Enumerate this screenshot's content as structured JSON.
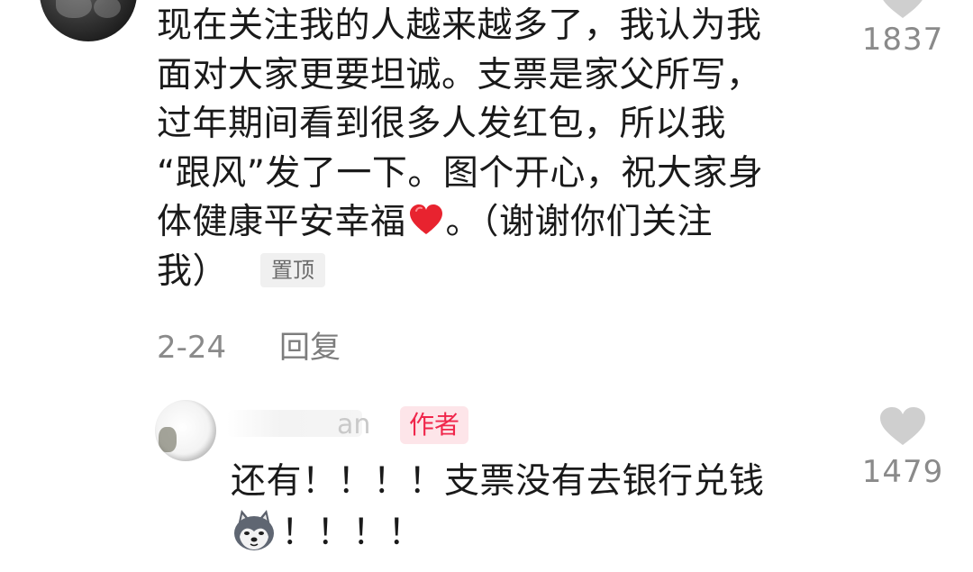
{
  "comment": {
    "lines": [
      "现在关注我的人越来越多了，我认为我",
      "面对大家更要坦诚。支票是家父所写，",
      "过年期间看到很多人发红包，所以我",
      "“跟风”发了一下。图个开心，祝大家身",
      "体健康平安幸福",
      "。（谢谢你们关注",
      "我）"
    ],
    "pin_badge": "置顶",
    "date": "2-24",
    "reply_label": "回复",
    "like_count": "1837"
  },
  "reply": {
    "name_partial": "an",
    "author_badge": "作者",
    "lines": [
      "还有！！！！支票没有去银行兑钱",
      "！！！！"
    ],
    "like_count": "1479"
  },
  "colors": {
    "text": "#1a1a1a",
    "meta": "#8a8a8a",
    "heart_icon": "#cfcfcf",
    "author_badge_bg": "#fde5e9",
    "author_badge_text": "#f0264b",
    "pin_badge_bg": "#f0f0f0",
    "emoji_heart": "#e8232f"
  },
  "icons": {
    "like": "heart-outline-filled-gray",
    "inline_emoji_1": "red-heart-emoji",
    "inline_emoji_2": "husky-dog-emoji"
  }
}
